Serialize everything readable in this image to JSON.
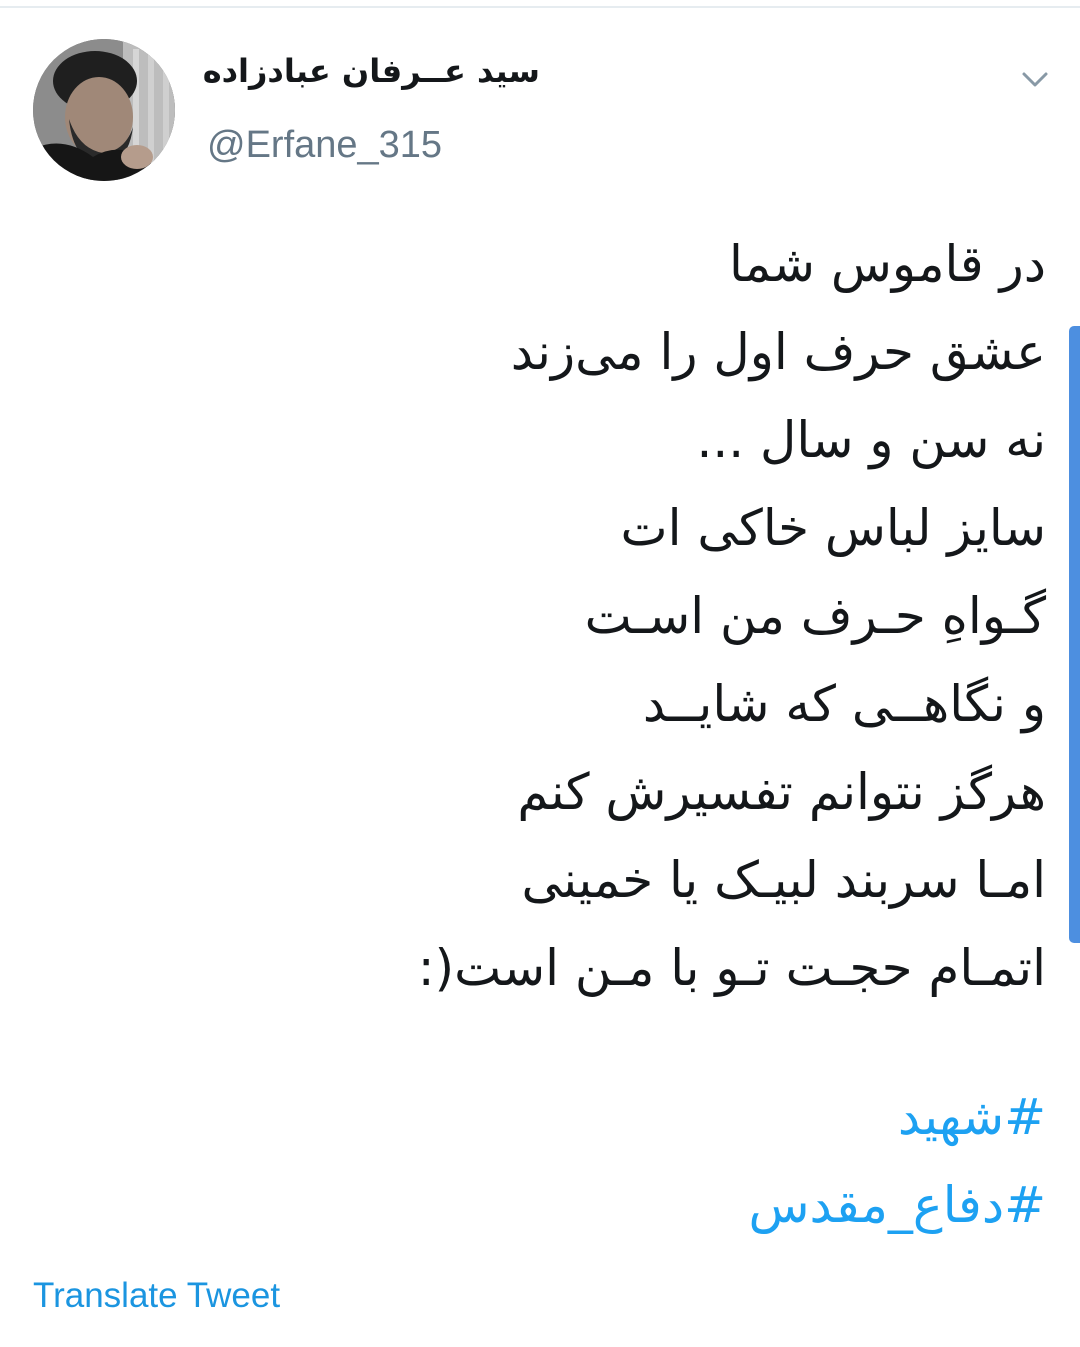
{
  "tweet": {
    "author": {
      "display_name": "سید عــرفان عبادزاده",
      "handle": "@Erfane_315"
    },
    "menu_icon": "chevron-down-icon",
    "text_lines": [
      "در قاموس شما",
      "عشق حرف اول را می‌زند",
      "نه سن و سال ...",
      "سایز لباس خاکی ات",
      "گـواهِ حـرف من اسـت",
      "و نگاهــی که شایــد",
      "هرگز نتوانم تفسیرش کنم",
      "امـا سربند لبیـک یا خمینی",
      "اتمـام حجـت تـو با مـن است(:"
    ],
    "hashtags": [
      "#شهید",
      "#دفاع_مقدس"
    ],
    "translate_label": "Translate Tweet"
  },
  "colors": {
    "link": "#1da1f2",
    "text": "#14171a",
    "secondary": "#657786",
    "scrollbar": "#4d8fe0"
  }
}
